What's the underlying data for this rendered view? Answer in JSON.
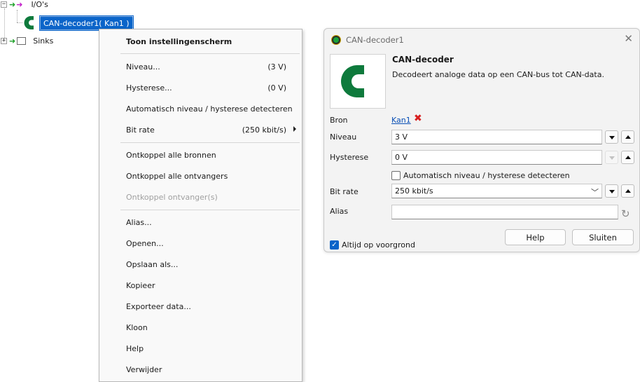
{
  "tree": {
    "ios_label": "I/O's",
    "selected_label": "CAN-decoder1( Kan1 )",
    "sinks_label": "Sinks",
    "expand_symbol": "+",
    "collapse_symbol": "−"
  },
  "context_menu": {
    "items": [
      {
        "label": "Toon instellingenscherm",
        "value": ""
      },
      {
        "label": "Niveau...",
        "value": "(3 V)"
      },
      {
        "label": "Hysterese...",
        "value": "(0 V)"
      },
      {
        "label": "Automatisch niveau / hysterese detecteren",
        "value": ""
      },
      {
        "label": "Bit rate",
        "value": "(250 kbit/s)"
      },
      {
        "label": "Ontkoppel alle bronnen",
        "value": ""
      },
      {
        "label": "Ontkoppel alle ontvangers",
        "value": ""
      },
      {
        "label": "Ontkoppel ontvanger(s)",
        "value": ""
      },
      {
        "label": "Alias...",
        "value": ""
      },
      {
        "label": "Openen...",
        "value": ""
      },
      {
        "label": "Opslaan als...",
        "value": ""
      },
      {
        "label": "Kopieer",
        "value": ""
      },
      {
        "label": "Exporteer data...",
        "value": ""
      },
      {
        "label": "Kloon",
        "value": ""
      },
      {
        "label": "Help",
        "value": ""
      },
      {
        "label": "Verwijder",
        "value": ""
      }
    ]
  },
  "dialog": {
    "title": "CAN-decoder1",
    "close_glyph": "✕",
    "heading": "CAN-decoder",
    "description": "Decodeert analoge data op een CAN-bus tot CAN-data.",
    "bron_label": "Bron",
    "bron_link": "Kan1",
    "remove_glyph": "✖",
    "niveau_label": "Niveau",
    "niveau_value": "3 V",
    "hysterese_label": "Hysterese",
    "hysterese_value": "0 V",
    "auto_detect_label": "Automatisch niveau / hysterese detecteren",
    "auto_detect_checked": false,
    "bitrate_label": "Bit rate",
    "bitrate_value": "250 kbit/s",
    "alias_label": "Alias",
    "alias_value": "",
    "reset_glyph": "↻",
    "help_button": "Help",
    "close_button": "Sluiten",
    "always_on_top_label": "Altijd op voorgrond",
    "always_on_top_checked": true
  },
  "colors": {
    "selection": "#0a64c9",
    "can_logo_green": "#0e7a3c",
    "link": "#0a4fb5",
    "remove_red": "#d81f1f"
  },
  "icons": {
    "tree_arrow": "green-right-arrow-icon",
    "can_logo": "can-decoder-logo-icon",
    "reset": "reset-icon"
  }
}
